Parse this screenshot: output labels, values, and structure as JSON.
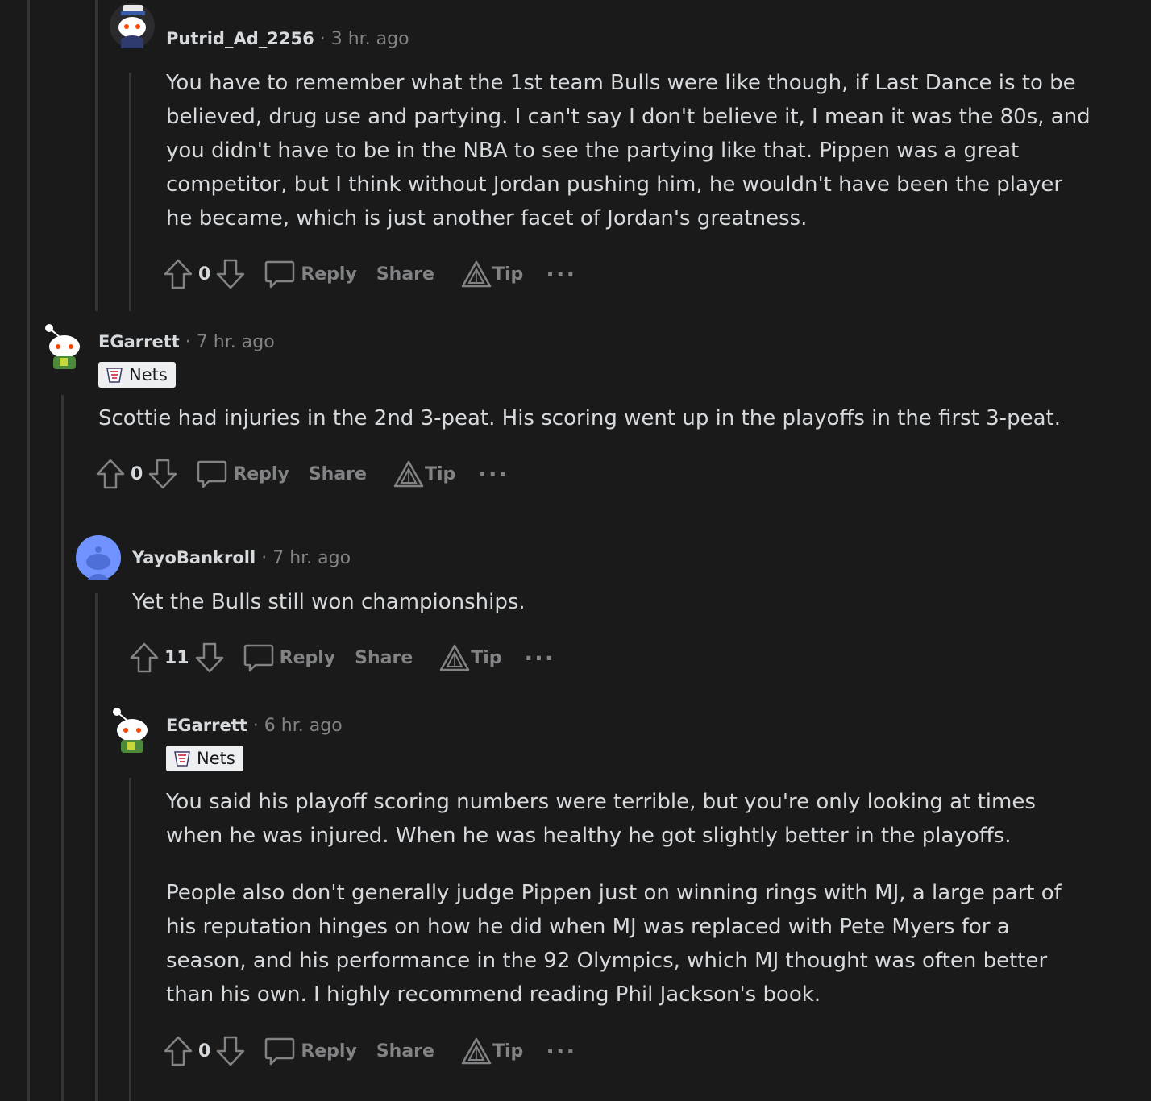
{
  "comments": [
    {
      "author": "Putrid_Ad_2256",
      "separator": "·",
      "time": "3 hr. ago",
      "flair": null,
      "paragraphs": [
        "You have to remember what the 1st team Bulls were like though, if Last Dance is to be",
        "believed, drug use and partying. I can't say I don't believe it, I mean it was the 80s, and",
        "you didn't have to be in the NBA to see the partying like that. Pippen was a great",
        "competitor, but I think without Jordan pushing him, he wouldn't have been the player",
        "he became, which is just another facet of Jordan's greatness."
      ],
      "score": "0"
    },
    {
      "author": "EGarrett",
      "separator": "·",
      "time": "7 hr. ago",
      "flair": "Nets",
      "paragraphs": [
        "Scottie had injuries in the 2nd 3-peat. His scoring went up in the playoffs in the first 3-peat."
      ],
      "score": "0"
    },
    {
      "author": "YayoBankroll",
      "separator": "·",
      "time": "7 hr. ago",
      "flair": null,
      "paragraphs": [
        "Yet the Bulls still won championships."
      ],
      "score": "11"
    },
    {
      "author": "EGarrett",
      "separator": "·",
      "time": "6 hr. ago",
      "flair": "Nets",
      "paragraph_groups": [
        [
          "You said his playoff scoring numbers were terrible, but you're only looking at times",
          "when he was injured. When he was healthy he got slightly better in the playoffs."
        ],
        [
          "People also don't generally judge Pippen just on winning rings with MJ, a large part of",
          "his reputation hinges on how he did when MJ was replaced with Pete Myers for a",
          "season, and his performance in the 92 Olympics, which MJ thought was often better",
          "than his own. I highly recommend reading Phil Jackson's book."
        ]
      ],
      "score": "0"
    }
  ],
  "actions": {
    "reply_label": "Reply",
    "share_label": "Share",
    "tip_label": "Tip",
    "more_label": "···"
  },
  "icons": {
    "upvote": "upvote-arrow-icon",
    "downvote": "downvote-arrow-icon",
    "reply": "speech-bubble-icon",
    "tip": "triangle-tip-icon",
    "more": "ellipsis-icon"
  },
  "colors": {
    "background": "#1a1a1b",
    "text": "#d7dadc",
    "muted": "#818384",
    "thread_line": "#343536",
    "flair_bg": "#edeff1",
    "default_avatar": "#7193ff"
  }
}
